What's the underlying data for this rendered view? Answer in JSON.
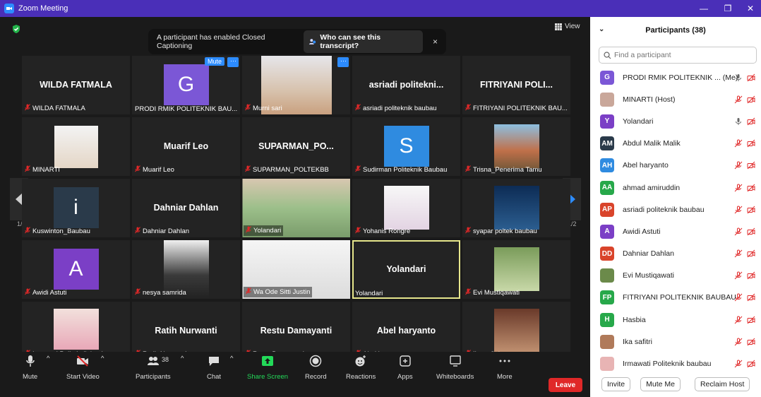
{
  "window": {
    "title": "Zoom Meeting"
  },
  "view_label": "View",
  "banner": {
    "text": "A participant has enabled Closed Captioning",
    "link": "Who can see this transcript?",
    "close": "×"
  },
  "pager": {
    "left": "1/2",
    "right": "1/2"
  },
  "mute_badge": "Mute",
  "more_badge": "···",
  "tiles": [
    {
      "big": "WILDA FATMALA",
      "label": "WILDA FATMALA"
    },
    {
      "avatar": "G",
      "avatar_color": "#7b57d6",
      "label": "PRODI RMIK POLITEKNIK BAU..."
    },
    {
      "label": "Murni sari"
    },
    {
      "big": "asriadi politekni...",
      "label": "asriadi politeknik baubau"
    },
    {
      "big": "FITRIYANI POLI...",
      "label": "FITRIYANI POLITEKNIK BAU..."
    },
    {
      "label": "MINARTI"
    },
    {
      "big": "Muarif Leo",
      "label": "Muarif Leo"
    },
    {
      "big": "SUPARMAN_PO...",
      "label": "SUPARMAN_POLTEKBB"
    },
    {
      "avatar": "S",
      "avatar_color": "#2f8be0",
      "label": "Sudirman Politeknik Baubau"
    },
    {
      "label": "Trisna_Penerima Tamu"
    },
    {
      "avatar": "i",
      "avatar_color": "#2a3a4a",
      "label": "Kuswinton_Baubau"
    },
    {
      "big": "Dahniar Dahlan",
      "label": "Dahniar Dahlan"
    },
    {
      "label": "Yolandari"
    },
    {
      "label": "Yohanis Rongre"
    },
    {
      "label": "syapar poltek baubau"
    },
    {
      "avatar": "A",
      "avatar_color": "#7b3fc6",
      "label": "Awidi Astuti"
    },
    {
      "label": "nesya samrida"
    },
    {
      "label": "Wa Ode Sitti Justin"
    },
    {
      "big": "Yolandari",
      "label": "Yolandari"
    },
    {
      "label": "Evi Mustiqawati"
    },
    {
      "label": "Irmawati Politeknik baubau"
    },
    {
      "big": "Ratih Nurwanti",
      "label": "Ratih Nurwanti"
    },
    {
      "big": "Restu Damayanti",
      "label": "Restu Damayanti"
    },
    {
      "big": "Abel haryanto",
      "label": "Abel haryanto"
    },
    {
      "label": "Ika safitri"
    }
  ],
  "toolbar": {
    "mute": "Mute",
    "start_video": "Start Video",
    "participants": "Participants",
    "participants_count": "38",
    "chat": "Chat",
    "share_screen": "Share Screen",
    "record": "Record",
    "reactions": "Reactions",
    "apps": "Apps",
    "whiteboards": "Whiteboards",
    "more": "More",
    "leave": "Leave"
  },
  "panel": {
    "title": "Participants (38)",
    "search_placeholder": "Find a participant",
    "invite": "Invite",
    "mute_me": "Mute Me",
    "reclaim_host": "Reclaim Host",
    "participants": [
      {
        "initials": "G",
        "color": "#7b57d6",
        "name": "PRODI RMIK POLITEKNIK ... (Me)"
      },
      {
        "initials": "",
        "color": "#c9a79a",
        "name": "MINARTI (Host)"
      },
      {
        "initials": "Y",
        "color": "#7b3fc6",
        "name": "Yolandari"
      },
      {
        "initials": "AM",
        "color": "#2a3a4a",
        "name": "Abdul Malik Malik"
      },
      {
        "initials": "AH",
        "color": "#2f8be0",
        "name": "Abel haryanto"
      },
      {
        "initials": "AA",
        "color": "#27a84a",
        "name": "ahmad amiruddin"
      },
      {
        "initials": "AP",
        "color": "#d9442b",
        "name": "asriadi politeknik baubau"
      },
      {
        "initials": "A",
        "color": "#7b3fc6",
        "name": "Awidi Astuti"
      },
      {
        "initials": "DD",
        "color": "#d9442b",
        "name": "Dahniar Dahlan"
      },
      {
        "initials": "",
        "color": "#6b8a4a",
        "name": "Evi Mustiqawati"
      },
      {
        "initials": "FP",
        "color": "#27a84a",
        "name": "FITRIYANI POLITEKNIK BAUBAU"
      },
      {
        "initials": "H",
        "color": "#27a84a",
        "name": "Hasbia"
      },
      {
        "initials": "",
        "color": "#b07a5a",
        "name": "Ika safitri"
      },
      {
        "initials": "",
        "color": "#e8b4b4",
        "name": "Irmawati Politeknik baubau"
      }
    ]
  }
}
